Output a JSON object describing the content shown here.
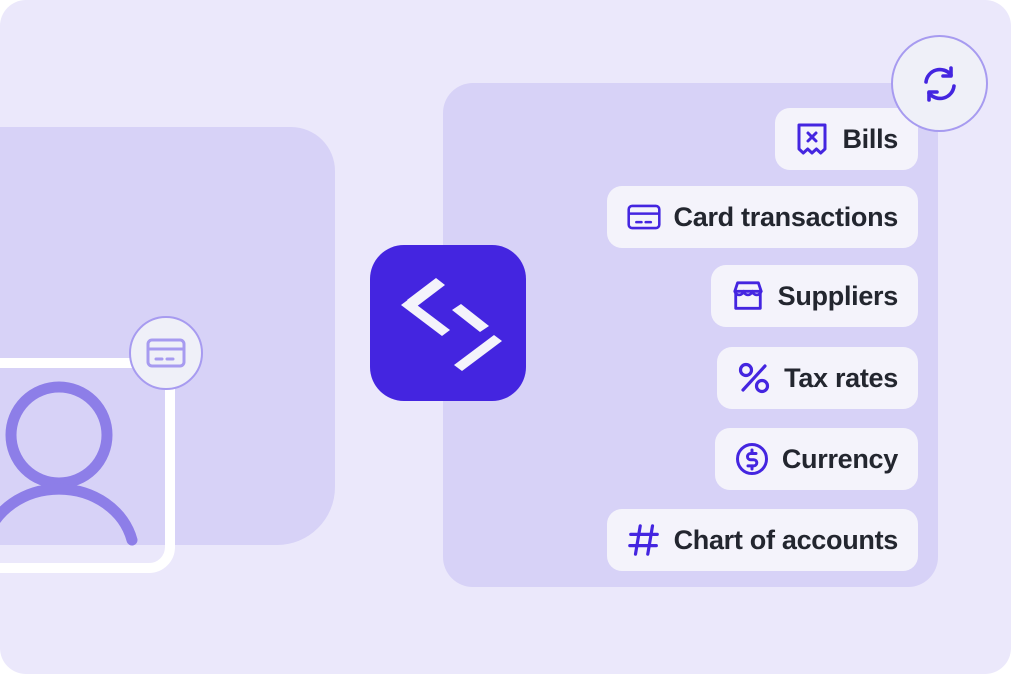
{
  "colors": {
    "canvas_bg": "#ebe8fb",
    "panel_bg": "#d7d2f7",
    "pill_bg": "#f4f3fb",
    "accent_purple": "#4425e0",
    "soft_purple": "#a79bf0",
    "logo_bg": "#4425e0",
    "text_dark": "#23262f",
    "white": "#ffffff"
  },
  "left_panel": {
    "avatar": {
      "icon": "user-avatar-icon"
    },
    "badge": {
      "icon": "credit-card-icon"
    }
  },
  "center": {
    "logo": {
      "icon": "code-brackets-logo-icon"
    }
  },
  "right_panel": {
    "badge": {
      "icon": "sync-refresh-icon"
    },
    "pills": [
      {
        "id": "bills",
        "label": "Bills",
        "icon": "receipt-x-icon"
      },
      {
        "id": "card",
        "label": "Card transactions",
        "icon": "credit-card-icon"
      },
      {
        "id": "suppliers",
        "label": "Suppliers",
        "icon": "storefront-icon"
      },
      {
        "id": "tax",
        "label": "Tax rates",
        "icon": "percent-icon"
      },
      {
        "id": "currency",
        "label": "Currency",
        "icon": "dollar-circle-icon"
      },
      {
        "id": "chart",
        "label": "Chart of accounts",
        "icon": "hash-icon"
      }
    ]
  }
}
